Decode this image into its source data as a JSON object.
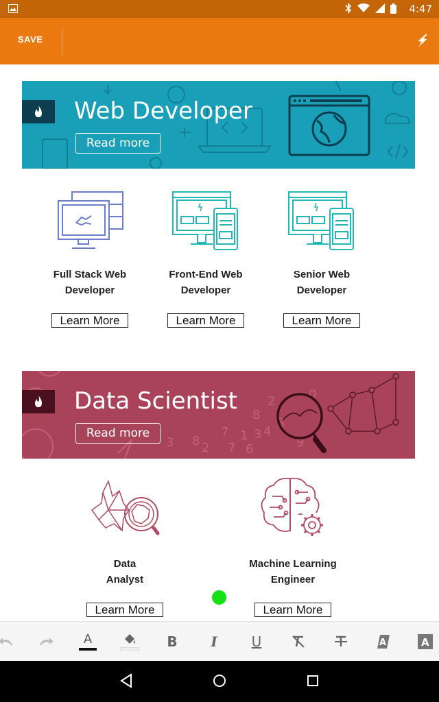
{
  "status_bar": {
    "time": "4:47"
  },
  "app_bar": {
    "save_label": "SAVE"
  },
  "colors": {
    "accent": "#ea790f",
    "status": "#c46508",
    "web_banner": "#1a9fb8",
    "data_banner": "#a8435a"
  },
  "banners": [
    {
      "title": "Web Developer",
      "button": "Read more"
    },
    {
      "title": "Data Scientist",
      "button": "Read more"
    }
  ],
  "web_jobs": [
    {
      "line1": "Full Stack Web",
      "line2": "Developer",
      "button": "Learn More"
    },
    {
      "line1": "Front-End Web",
      "line2": "Developer",
      "button": "Learn More"
    },
    {
      "line1": "Senior Web",
      "line2": "Developer",
      "button": "Learn More"
    }
  ],
  "data_jobs": [
    {
      "line1": "Data",
      "line2": "Analyst",
      "button": "Learn More"
    },
    {
      "line1": "Machine Learning",
      "line2": "Engineer",
      "button": "Learn More"
    }
  ],
  "toolbar": {
    "bold": "B",
    "italic": "I",
    "underline": "U",
    "text_color": "A",
    "highlight": "A",
    "icons": [
      "undo-icon",
      "redo-icon",
      "text-color-icon",
      "fill-color-icon",
      "bold-icon",
      "italic-icon",
      "underline-icon",
      "clear-format-icon",
      "strikethrough-icon",
      "text-shadow-icon",
      "text-background-icon"
    ]
  }
}
